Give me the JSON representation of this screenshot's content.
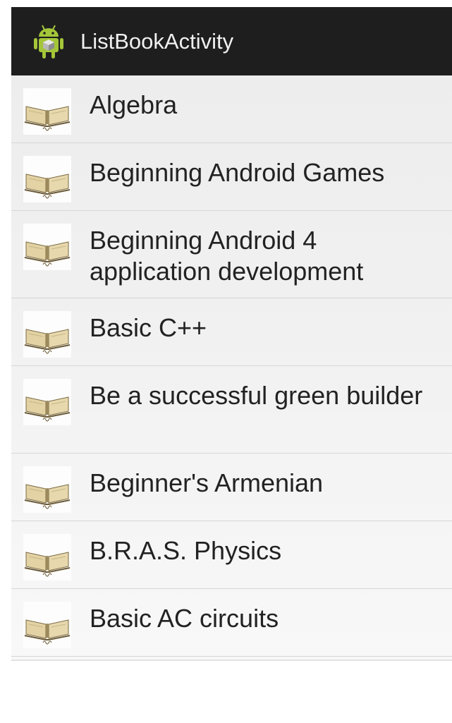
{
  "action_bar": {
    "title": "ListBookActivity",
    "icon": "android-robot-icon"
  },
  "books": [
    {
      "title": "Algebra",
      "icon": "book-icon"
    },
    {
      "title": "Beginning Android Games",
      "icon": "book-icon"
    },
    {
      "title": "Beginning Android 4 application development",
      "icon": "book-icon"
    },
    {
      "title": "Basic C++",
      "icon": "book-icon"
    },
    {
      "title": "Be a successful green builder",
      "icon": "book-icon"
    },
    {
      "title": "Beginner's Armenian",
      "icon": "book-icon"
    },
    {
      "title": "B.R.A.S. Physics",
      "icon": "book-icon"
    },
    {
      "title": "Basic AC circuits",
      "icon": "book-icon"
    }
  ],
  "colors": {
    "action_bar_bg": "#1e1e1e",
    "action_bar_text": "#f0f0f0",
    "list_text": "#222222",
    "android_green": "#a4c639"
  }
}
